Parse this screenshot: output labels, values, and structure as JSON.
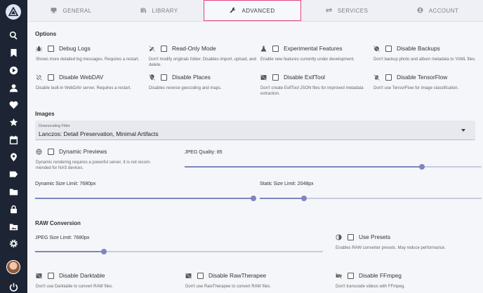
{
  "sidebar": {
    "items": [
      {
        "name": "search-icon"
      },
      {
        "name": "bookmark-icon"
      },
      {
        "name": "play-circle-icon"
      },
      {
        "name": "person-icon"
      },
      {
        "name": "heart-icon"
      },
      {
        "name": "star-icon"
      },
      {
        "name": "calendar-icon"
      },
      {
        "name": "map-marker-icon"
      },
      {
        "name": "label-icon"
      },
      {
        "name": "folder-icon"
      },
      {
        "name": "lock-icon"
      },
      {
        "name": "folder-image-icon"
      },
      {
        "name": "gear-icon"
      },
      {
        "name": "power-icon"
      }
    ]
  },
  "tabs": [
    {
      "label": "GENERAL",
      "icon": "monitor-icon",
      "active": false
    },
    {
      "label": "LIBRARY",
      "icon": "library-icon",
      "active": false
    },
    {
      "label": "ADVANCED",
      "icon": "wrench-icon",
      "active": true
    },
    {
      "label": "SERVICES",
      "icon": "swap-icon",
      "active": false
    },
    {
      "label": "ACCOUNT",
      "icon": "account-icon",
      "active": false
    }
  ],
  "accent_color": "#e0457b",
  "slider_color": "#7f85bd",
  "options": {
    "title": "Options",
    "debug_logs": {
      "label": "Debug Logs",
      "desc": "Shows more detailed log messages. Requires a restart."
    },
    "read_only": {
      "label": "Read-Only Mode",
      "desc": "Don't modify originals folder. Disables import, upload, and delete."
    },
    "experimental": {
      "label": "Experimental Features",
      "desc": "Enable new features currently under development."
    },
    "disable_backups": {
      "label": "Disable Backups",
      "desc": "Don't backup photo and album metadata to YAML files."
    },
    "disable_webdav": {
      "label": "Disable WebDAV",
      "desc": "Disable built-in WebDAV server. Requires a restart."
    },
    "disable_places": {
      "label": "Disable Places",
      "desc": "Disables reverse geocoding and maps."
    },
    "disable_exiftool": {
      "label": "Disable ExifTool",
      "desc": "Don't create ExifTool JSON files for improved metadata extraction."
    },
    "disable_tensorflow": {
      "label": "Disable TensorFlow",
      "desc": "Don't use TensorFlow for image classification."
    }
  },
  "images": {
    "title": "Images",
    "downscaling": {
      "label": "Downscaling Filter",
      "value": "Lanczos: Detail Preservation, Minimal Artifacts"
    },
    "dynamic_previews": {
      "label": "Dynamic Previews",
      "desc": "Dynamic rendering requires a powerful server. It is not recom- mended for NAS devices."
    },
    "jpeg_quality": {
      "label": "JPEG Quality: 85",
      "level": 0.8
    },
    "dynamic_size_limit": {
      "label": "Dynamic Size Limit: 7680px",
      "level": 1.0
    },
    "static_size_limit": {
      "label": "Static Size Limit: 2048px",
      "level": 0.2
    }
  },
  "raw": {
    "title": "RAW Conversion",
    "jpeg_size_limit": {
      "label": "JPEG Size Limit: 7680px",
      "level": 0.24
    },
    "use_presets": {
      "label": "Use Presets",
      "desc": "Enables RAW converter presets. May reduce performance."
    },
    "disable_darktable": {
      "label": "Disable Darktable",
      "desc": "Don't use Darktable to convert RAW files."
    },
    "disable_rawtherapee": {
      "label": "Disable RawTherapee",
      "desc": "Don't use RawTherapee to convert RAW files."
    },
    "disable_ffmpeg": {
      "label": "Disable FFmpeg",
      "desc": "Don't transcode videos with FFmpeg."
    }
  }
}
